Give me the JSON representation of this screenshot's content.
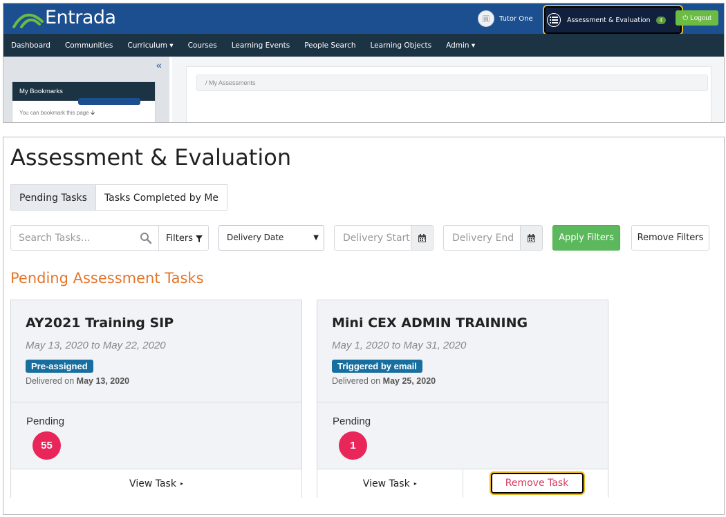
{
  "header": {
    "logo_text": "Entrada",
    "avatar_glyph": "🖼",
    "user_name": "Tutor One",
    "ae_label": "Assessment & Evaluation",
    "ae_badge": "4",
    "logout_label": "Logout"
  },
  "nav": {
    "items": [
      "Dashboard",
      "Communities",
      "Curriculum ▾",
      "Courses",
      "Learning Events",
      "People Search",
      "Learning Objects",
      "Admin ▾"
    ]
  },
  "sidebar": {
    "collapse_glyph": "«",
    "bookmarks_title": "My Bookmarks",
    "bookmarks_text": "You can bookmark this page"
  },
  "breadcrumb": "/  My Assessments",
  "page": {
    "title": "Assessment & Evaluation",
    "tabs": [
      "Pending Tasks",
      "Tasks Completed by Me"
    ]
  },
  "filters": {
    "search_placeholder": "Search Tasks...",
    "filters_label": "Filters",
    "select_value": "Delivery Date",
    "delivery_start_placeholder": "Delivery Start",
    "delivery_end_placeholder": "Delivery End",
    "apply_label": "Apply Filters",
    "remove_label": "Remove Filters"
  },
  "section_title": "Pending Assessment Tasks",
  "cards": [
    {
      "name": "AY2021 Training SIP",
      "dates": "May 13, 2020 to May 22, 2020",
      "tag": "Pre-assigned",
      "delivered_prefix": "Delivered on",
      "delivered_date": "May 13, 2020",
      "status": "Pending",
      "count": "55",
      "view_label": "View Task"
    },
    {
      "name": "Mini CEX ADMIN TRAINING",
      "dates": "May 1, 2020 to May 31, 2020",
      "tag": "Triggered by email",
      "delivered_prefix": "Delivered on",
      "delivered_date": "May 25, 2020",
      "status": "Pending",
      "count": "1",
      "view_label": "View Task",
      "remove_label": "Remove Task"
    }
  ],
  "colors": {
    "header_blue": "#1b4f8f",
    "nav_dark": "#1c3344",
    "highlight": "#e9b824",
    "accent_orange": "#e4752a",
    "count_red": "#e8265a",
    "apply_green": "#5cb85c",
    "tag_blue": "#176e9f"
  }
}
